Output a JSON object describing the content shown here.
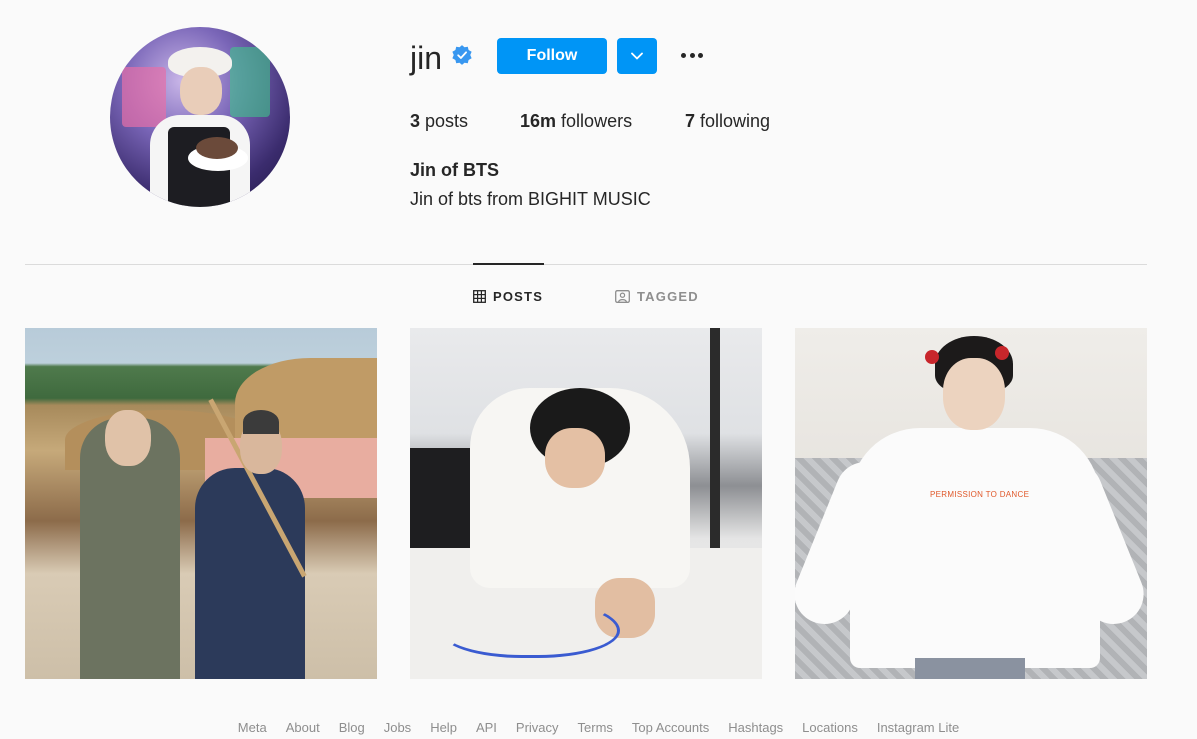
{
  "profile": {
    "username": "jin",
    "follow_label": "Follow",
    "stats": {
      "posts_count": "3",
      "posts_label": "posts",
      "followers_count": "16m",
      "followers_label": "followers",
      "following_count": "7",
      "following_label": "following"
    },
    "full_name": "Jin of BTS",
    "bio": "Jin of bts from BIGHIT MUSIC"
  },
  "tabs": [
    {
      "label": "POSTS",
      "icon": "grid-icon",
      "active": true
    },
    {
      "label": "TAGGED",
      "icon": "tagged-icon",
      "active": false
    }
  ],
  "posts": [
    {
      "icon": "photo-two-men-hanok-village"
    },
    {
      "icon": "photo-man-writing-on-shirt"
    },
    {
      "icon": "photo-man-white-longsleeve"
    }
  ],
  "post3_print": "PERMISSION TO DANCE",
  "footer_links": [
    "Meta",
    "About",
    "Blog",
    "Jobs",
    "Help",
    "API",
    "Privacy",
    "Terms",
    "Top Accounts",
    "Hashtags",
    "Locations",
    "Instagram Lite"
  ],
  "colors": {
    "accent": "#0095f6",
    "verified": "#3897f0",
    "background": "#fafafa",
    "text": "#262626",
    "muted": "#8e8e8e"
  }
}
